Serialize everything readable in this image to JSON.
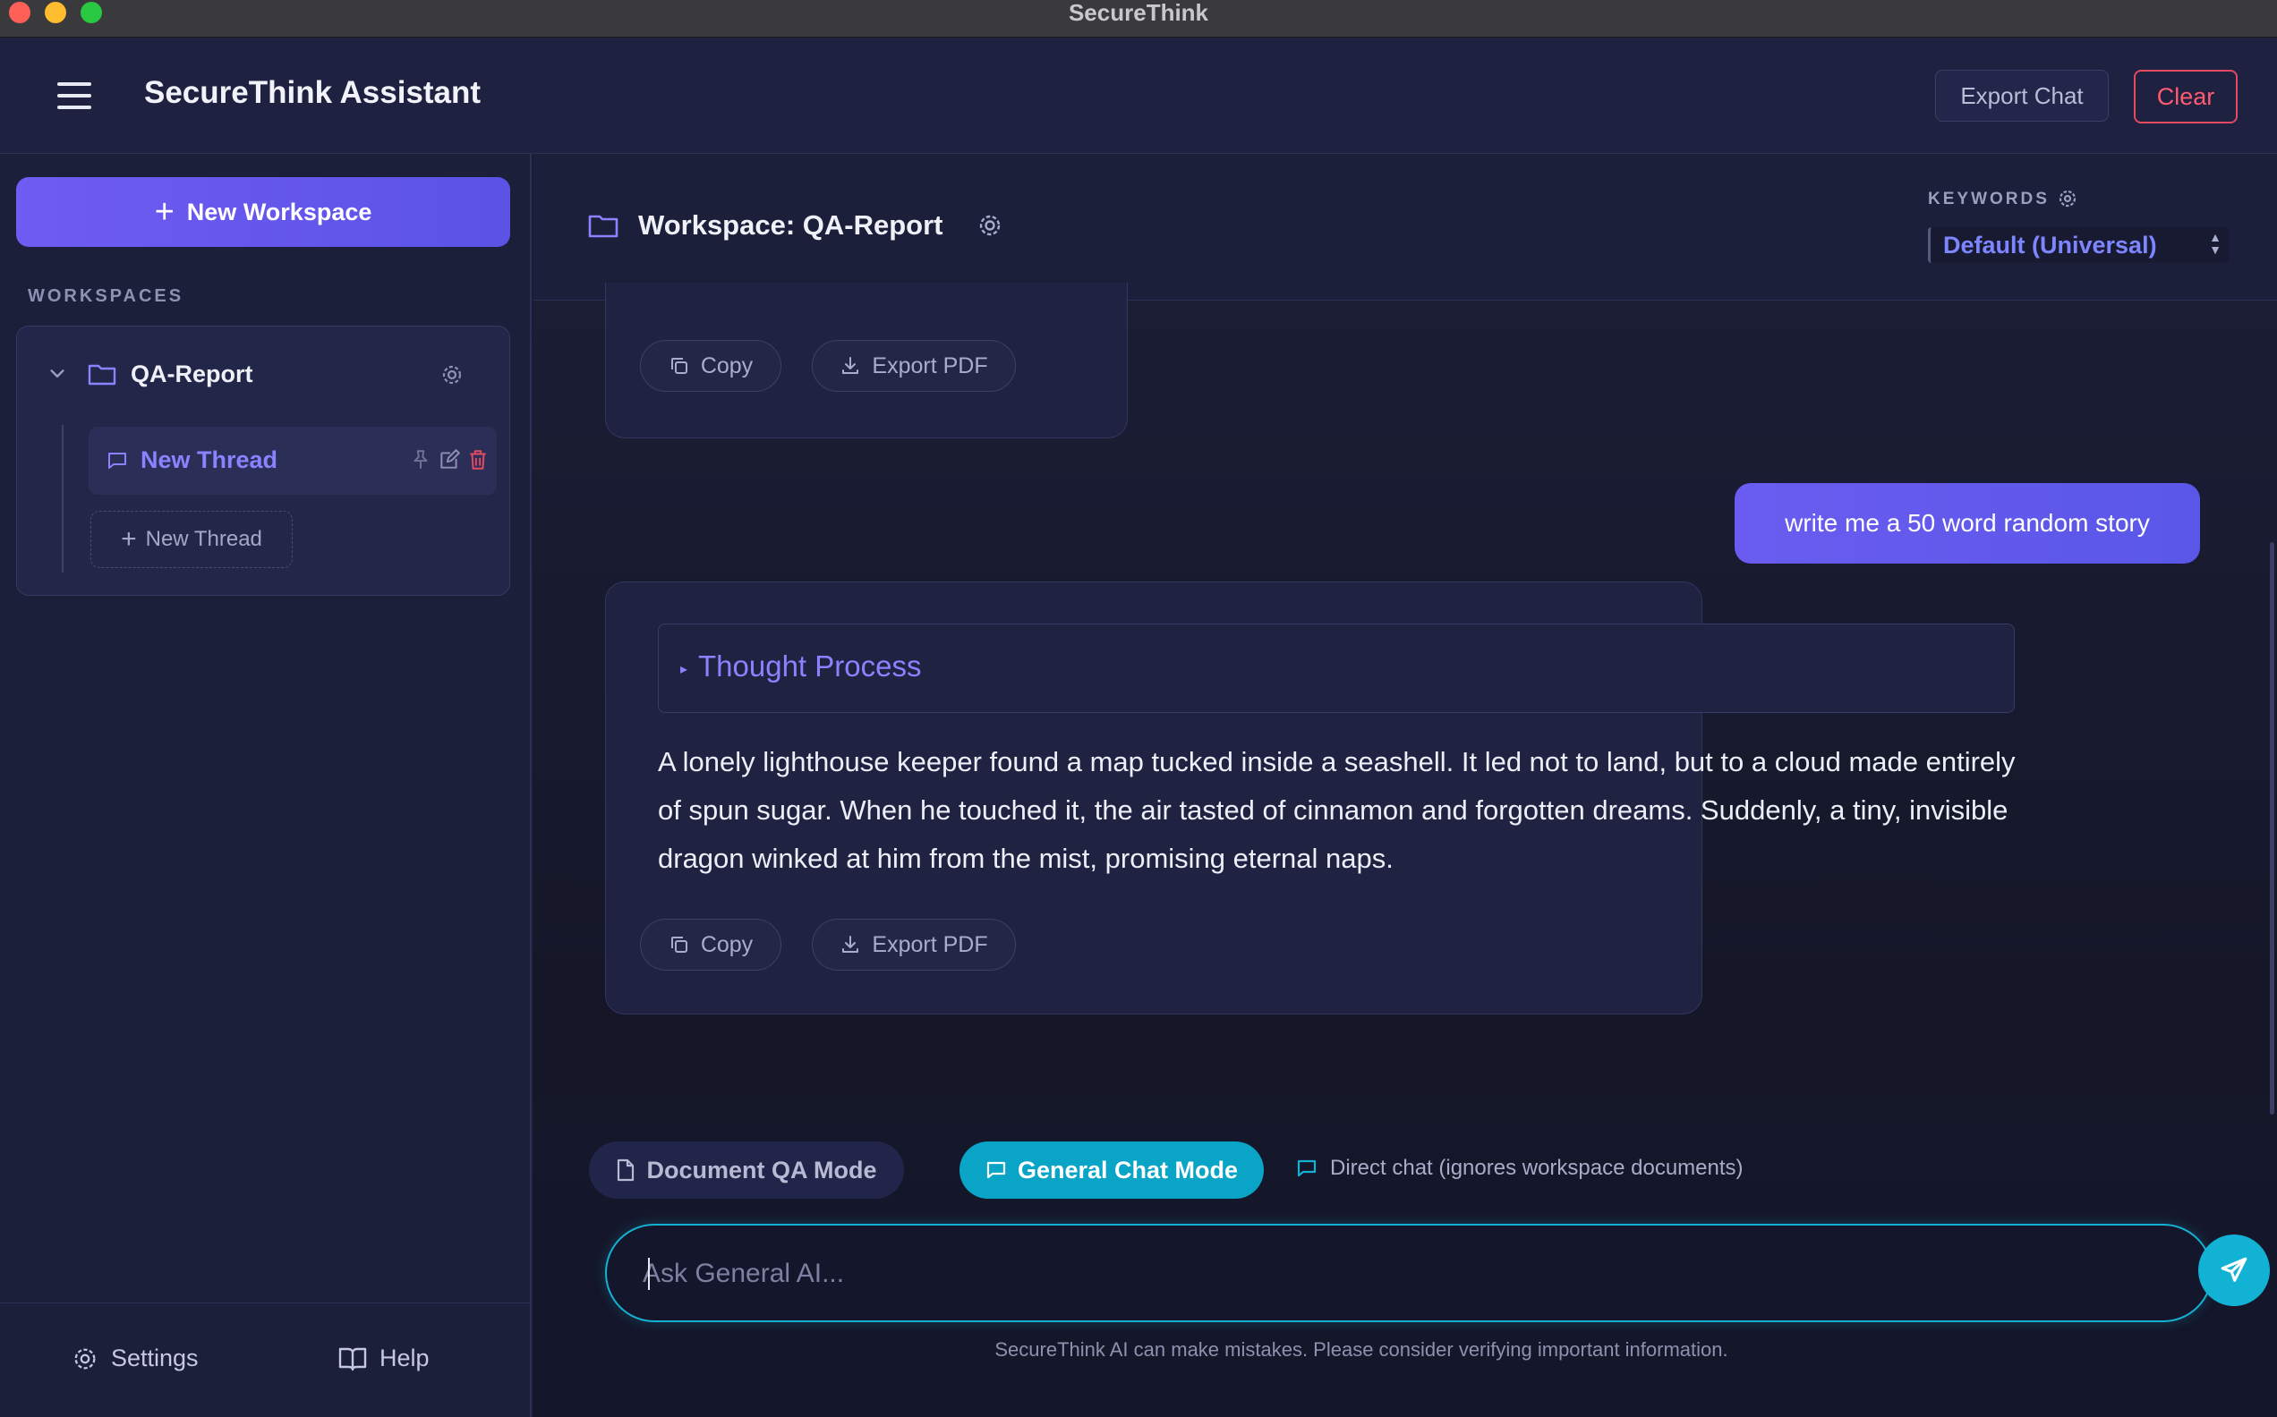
{
  "window": {
    "title": "SecureThink"
  },
  "header": {
    "app_title": "SecureThink Assistant",
    "export_label": "Export Chat",
    "clear_label": "Clear"
  },
  "sidebar": {
    "new_workspace_label": "New Workspace",
    "section_label": "WORKSPACES",
    "workspace": {
      "name": "QA-Report",
      "expanded": true,
      "threads": [
        {
          "name": "New Thread",
          "active": true
        }
      ],
      "new_thread_label": "New Thread"
    },
    "footer": {
      "settings_label": "Settings",
      "help_label": "Help"
    }
  },
  "main": {
    "workspace_title": "Workspace: QA-Report",
    "keywords_label": "KEYWORDS",
    "keywords_selected": "Default (Universal)"
  },
  "messages": [
    {
      "role": "assistant",
      "copy_label": "Copy",
      "export_label": "Export PDF"
    },
    {
      "role": "user",
      "text": "write me a 50 word random story"
    },
    {
      "role": "assistant",
      "thought_label": "Thought Process",
      "text": "A lonely lighthouse keeper found a map tucked inside a seashell. It led not to land, but to a cloud made entirely of spun sugar. When he touched it, the air tasted of cinnamon and forgotten dreams. Suddenly, a tiny, invisible dragon winked at him from the mist, promising eternal naps.",
      "copy_label": "Copy",
      "export_label": "Export PDF"
    }
  ],
  "composer": {
    "modes": [
      {
        "label": "Document QA Mode",
        "active": false
      },
      {
        "label": "General Chat Mode",
        "active": true
      }
    ],
    "mode_note": "Direct chat (ignores workspace documents)",
    "placeholder": "Ask General AI...",
    "disclaimer": "SecureThink AI can make mistakes. Please consider verifying important information."
  },
  "colors": {
    "accent_purple": "#6a5cf0",
    "accent_cyan": "#0aa5c6",
    "danger": "#ff5a70",
    "background": "#1a1c33"
  }
}
